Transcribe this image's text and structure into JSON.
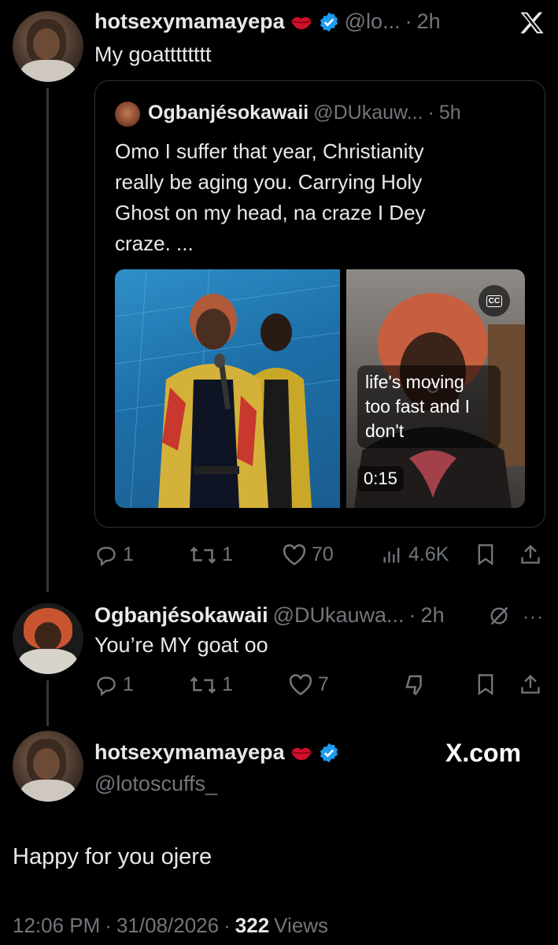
{
  "post1": {
    "display_name": "hotsexymamayepa",
    "handle": "@lo...",
    "time": "2h",
    "text": "My goatttttttt",
    "quote": {
      "display_name": "Ogbanjésokawaii",
      "handle": "@DUkauw...",
      "time": "5h",
      "text": "Omo I suffer that year, Christianity really be aging you. Carrying Holy Ghost on my head, na craze I Dey craze. ...",
      "video_caption": "life's moving too fast and I don't",
      "video_duration": "0:15",
      "cc_label": "CC"
    },
    "actions": {
      "replies": "1",
      "reposts": "1",
      "likes": "70",
      "views": "4.6K"
    }
  },
  "post2": {
    "display_name": "Ogbanjésokawaii",
    "handle": "@DUkauwa...",
    "time": "2h",
    "text": "You’re MY goat oo",
    "actions": {
      "replies": "1",
      "reposts": "1",
      "likes": "7"
    }
  },
  "post3": {
    "display_name": "hotsexymamayepa",
    "handle": "@lotoscuffs_",
    "text": "Happy for you ojere",
    "time": "12:06 PM",
    "date": "31/08/2026",
    "views_count": "322",
    "views_label": "Views"
  },
  "brand": {
    "watermark": "X.com"
  },
  "colors": {
    "verified": "#1d9bf0",
    "background": "#000000",
    "muted": "#71767b"
  },
  "icons": [
    "x-logo-icon",
    "lips-emoji-icon",
    "verified-badge-icon",
    "reply-icon",
    "repost-icon",
    "like-icon",
    "views-icon",
    "bookmark-icon",
    "share-icon",
    "more-icon",
    "grok-icon",
    "dislike-icon",
    "muted-icon"
  ]
}
